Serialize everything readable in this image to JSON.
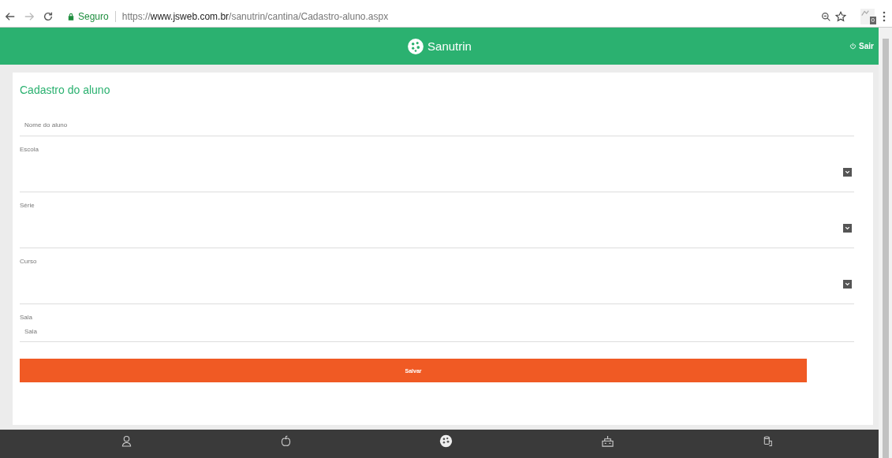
{
  "browser": {
    "security": "Seguro",
    "url_scheme": "https://",
    "url_host": "www.jsweb.com.br",
    "url_path": "/sanutrin/cantina/Cadastro-aluno.aspx",
    "extension_badge": "0"
  },
  "header": {
    "brand": "Sanutrin",
    "logout": "Sair"
  },
  "form": {
    "title": "Cadastro do aluno",
    "fields": [
      {
        "kind": "text",
        "placeholder": "Nome do aluno"
      },
      {
        "kind": "select",
        "label": "Escola"
      },
      {
        "kind": "select",
        "label": "Série"
      },
      {
        "kind": "select",
        "label": "Curso"
      },
      {
        "kind": "text",
        "label": "Sala",
        "placeholder": "Sala"
      }
    ],
    "submit": "Salvar"
  }
}
